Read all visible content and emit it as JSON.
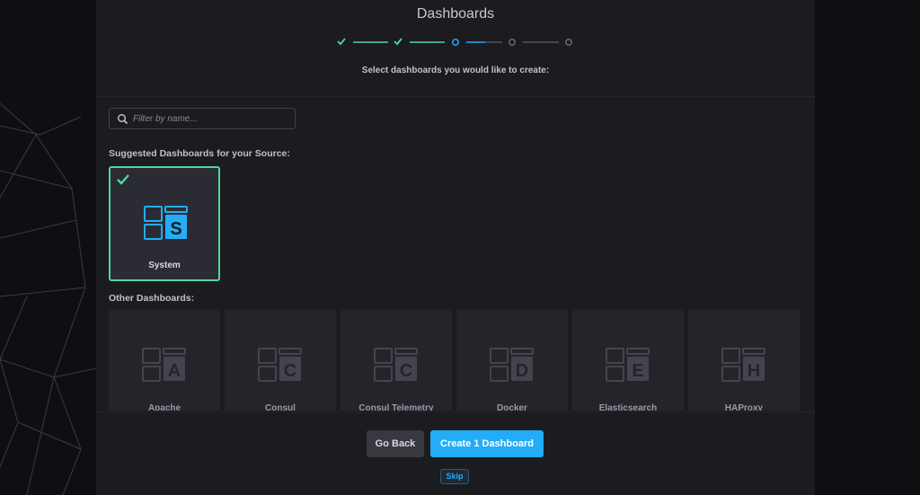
{
  "wizard": {
    "title": "Dashboards",
    "subtitle": "Select dashboards you would like to create:",
    "steps": [
      "complete",
      "complete",
      "current",
      "pending",
      "pending"
    ]
  },
  "filter": {
    "placeholder": "Filter by name..."
  },
  "suggested": {
    "label": "Suggested Dashboards for your Source:",
    "items": [
      {
        "name": "System",
        "letter": "S",
        "selected": true
      }
    ]
  },
  "other": {
    "label": "Other Dashboards:",
    "items": [
      {
        "name": "Apache",
        "letter": "A"
      },
      {
        "name": "Consul",
        "letter": "C"
      },
      {
        "name": "Consul Telemetry",
        "letter": "C"
      },
      {
        "name": "Docker",
        "letter": "D"
      },
      {
        "name": "Elasticsearch",
        "letter": "E"
      },
      {
        "name": "HAProxy",
        "letter": "H"
      }
    ]
  },
  "footer": {
    "back_label": "Go Back",
    "create_label": "Create 1 Dashboard",
    "skip_label": "Skip"
  },
  "colors": {
    "accent": "#22adf6",
    "success": "#4ed8a0"
  }
}
